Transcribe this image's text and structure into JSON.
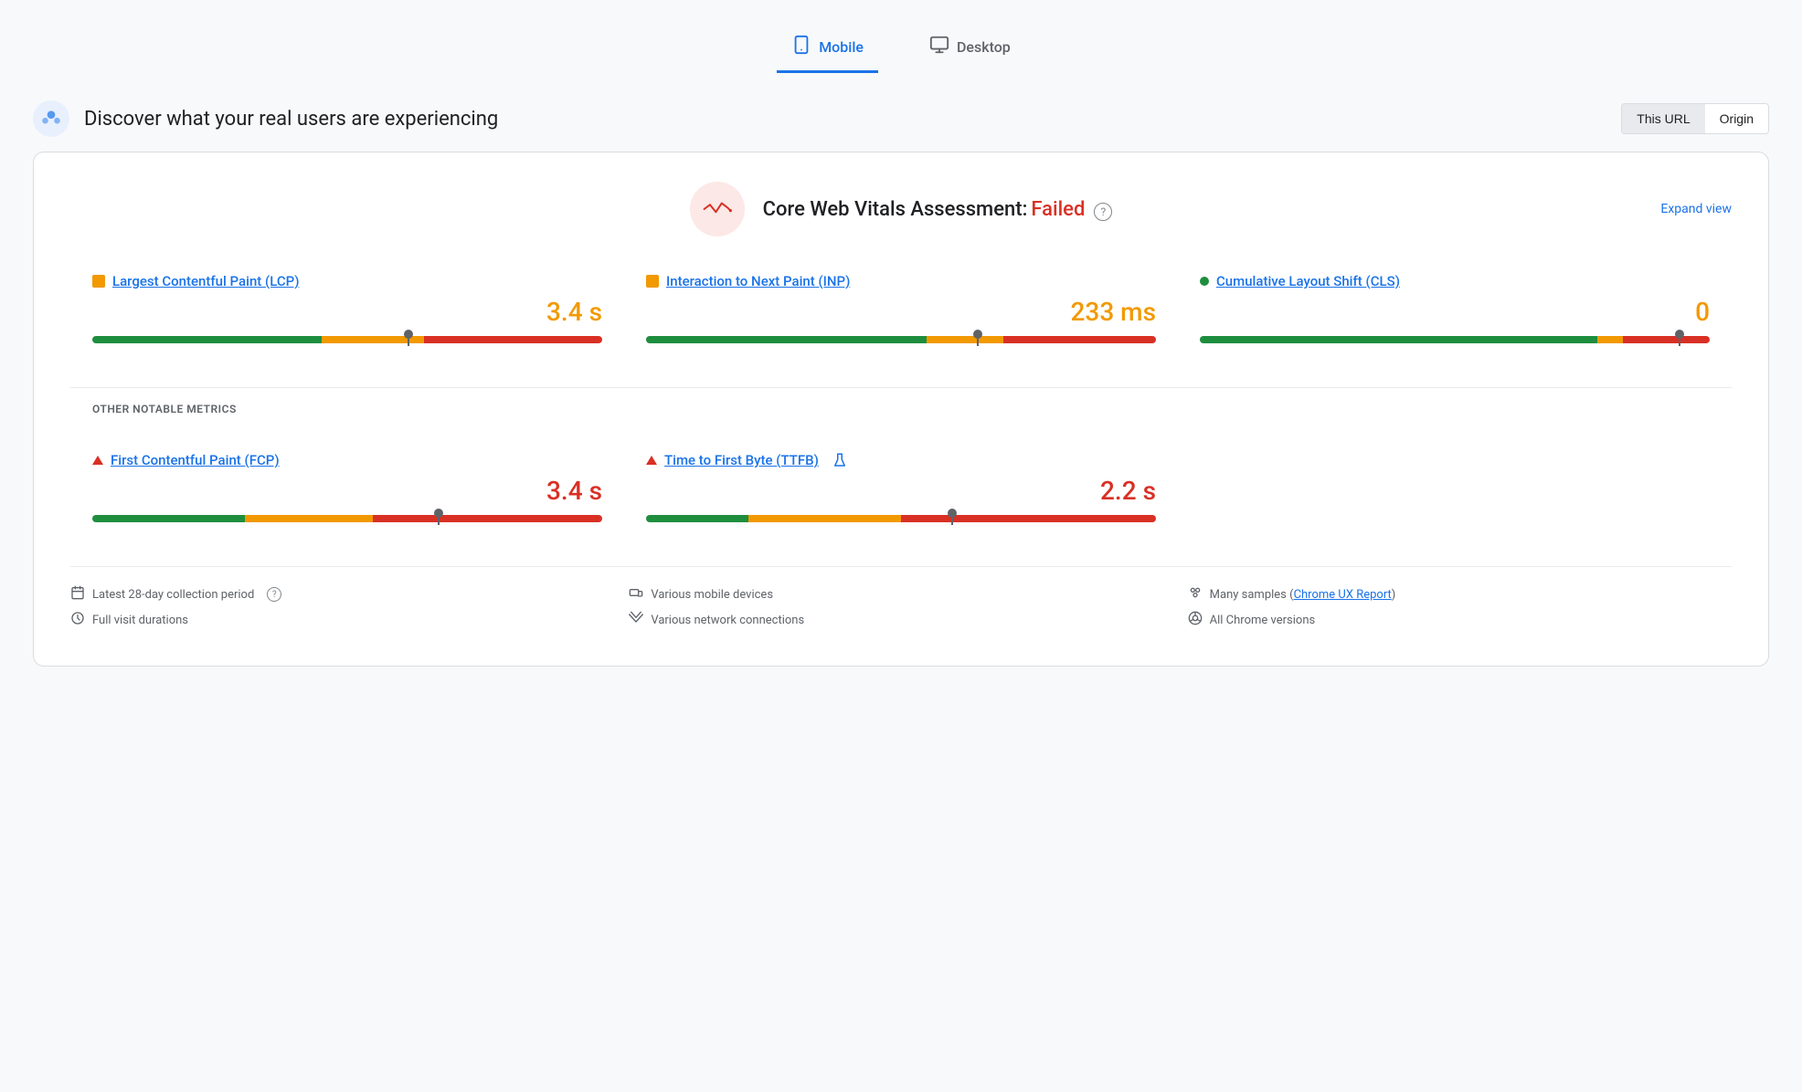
{
  "tabs": [
    {
      "id": "mobile",
      "label": "Mobile",
      "icon": "📱",
      "active": true
    },
    {
      "id": "desktop",
      "label": "Desktop",
      "icon": "🖥",
      "active": false
    }
  ],
  "header": {
    "title": "Discover what your real users are experiencing",
    "url_toggle": {
      "options": [
        "This URL",
        "Origin"
      ],
      "active": "This URL"
    }
  },
  "cwv": {
    "title": "Core Web Vitals Assessment:",
    "status": "Failed",
    "expand_label": "Expand view",
    "help_label": "?"
  },
  "metrics": [
    {
      "id": "lcp",
      "label": "Largest Contentful Paint (LCP)",
      "value": "3.4 s",
      "dot_color": "orange",
      "dot_shape": "square",
      "value_color": "orange",
      "bar": {
        "green": 45,
        "orange": 20,
        "red": 35,
        "marker_pct": 62
      }
    },
    {
      "id": "inp",
      "label": "Interaction to Next Paint (INP)",
      "value": "233 ms",
      "dot_color": "orange",
      "dot_shape": "square",
      "value_color": "orange",
      "bar": {
        "green": 55,
        "orange": 15,
        "red": 30,
        "marker_pct": 65
      }
    },
    {
      "id": "cls",
      "label": "Cumulative Layout Shift (CLS)",
      "value": "0",
      "dot_color": "green",
      "dot_shape": "circle",
      "value_color": "orange",
      "bar": {
        "green": 78,
        "orange": 5,
        "red": 17,
        "marker_pct": 94
      }
    }
  ],
  "other_metrics_label": "OTHER NOTABLE METRICS",
  "other_metrics": [
    {
      "id": "fcp",
      "label": "First Contentful Paint (FCP)",
      "value": "3.4 s",
      "icon": "triangle",
      "value_color": "red",
      "bar": {
        "green": 30,
        "orange": 25,
        "red": 45,
        "marker_pct": 68
      }
    },
    {
      "id": "ttfb",
      "label": "Time to First Byte (TTFB)",
      "value": "2.2 s",
      "icon": "triangle",
      "extra_icon": "flask",
      "value_color": "red",
      "bar": {
        "green": 20,
        "orange": 30,
        "red": 50,
        "marker_pct": 60
      }
    }
  ],
  "footer": {
    "col1": [
      {
        "icon": "📅",
        "text": "Latest 28-day collection period",
        "has_help": true
      },
      {
        "icon": "⏱",
        "text": "Full visit durations"
      }
    ],
    "col2": [
      {
        "icon": "📱",
        "text": "Various mobile devices"
      },
      {
        "icon": "📶",
        "text": "Various network connections"
      }
    ],
    "col3": [
      {
        "icon": "🔵",
        "text_before": "Many samples (",
        "link": "Chrome UX Report",
        "text_after": ")"
      },
      {
        "icon": "🌐",
        "text": "All Chrome versions"
      }
    ]
  }
}
